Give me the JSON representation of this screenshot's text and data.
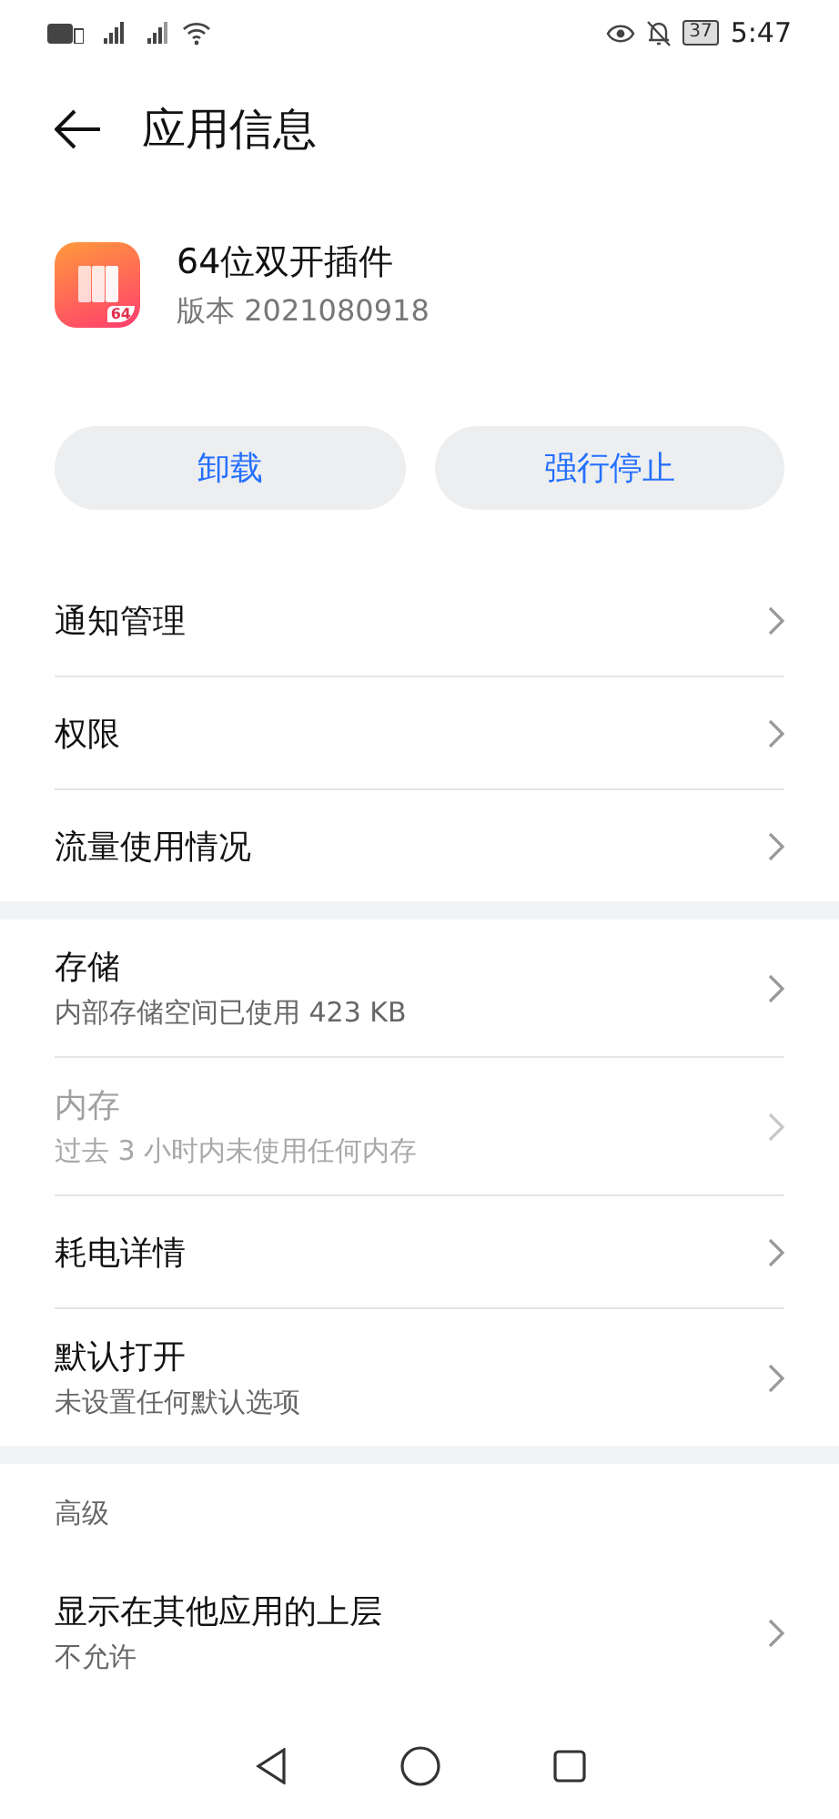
{
  "status_bar": {
    "battery": "37",
    "time": "5:47"
  },
  "header": {
    "title": "应用信息"
  },
  "app": {
    "name": "64位双开插件",
    "version": "版本 2021080918",
    "badge": "64"
  },
  "buttons": [
    "卸载",
    "强行停止"
  ],
  "groups": [
    {
      "items": [
        {
          "title": "通知管理",
          "disabled": false
        },
        {
          "title": "权限",
          "disabled": false
        },
        {
          "title": "流量使用情况",
          "disabled": false
        }
      ]
    },
    {
      "items": [
        {
          "title": "存储",
          "subtitle": "内部存储空间已使用 423 KB",
          "disabled": false
        },
        {
          "title": "内存",
          "subtitle": "过去 3 小时内未使用任何内存",
          "disabled": true
        },
        {
          "title": "耗电详情",
          "disabled": false
        },
        {
          "title": "默认打开",
          "subtitle": "未设置任何默认选项",
          "disabled": false
        }
      ]
    },
    {
      "heading": "高级",
      "items": [
        {
          "title": "显示在其他应用的上层",
          "subtitle": "不允许",
          "disabled": false
        }
      ]
    }
  ]
}
